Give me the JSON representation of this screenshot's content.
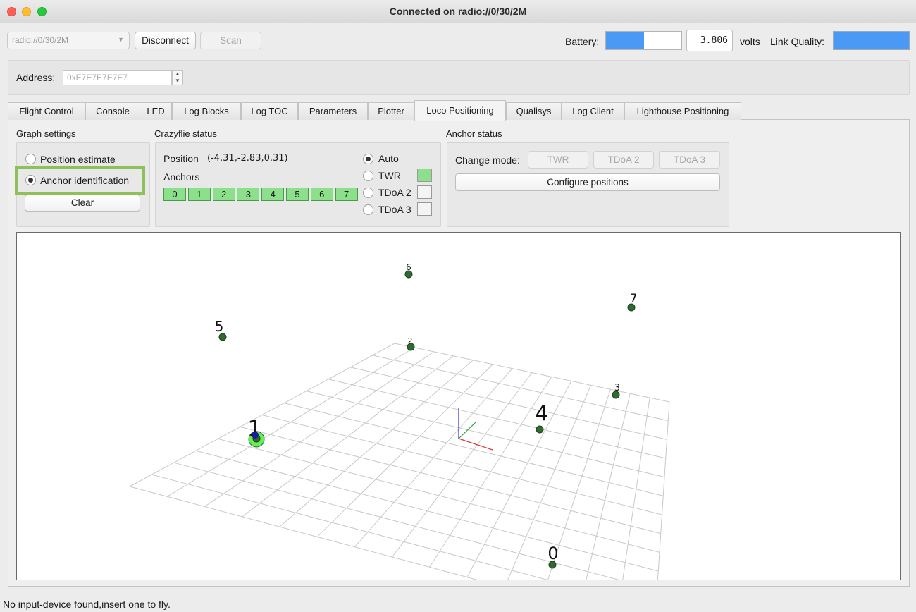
{
  "window": {
    "title": "Connected on radio://0/30/2M"
  },
  "connection": {
    "uri": "radio://0/30/2M",
    "disconnect_label": "Disconnect",
    "scan_label": "Scan",
    "battery_label": "Battery:",
    "battery_level": 0.5,
    "voltage": "3.806",
    "volts_label": "volts",
    "link_quality_label": "Link Quality:",
    "link_quality_level": 1.0
  },
  "address": {
    "label": "Address:",
    "value": "0xE7E7E7E7E7"
  },
  "tabs": [
    {
      "label": "Flight Control",
      "active": false
    },
    {
      "label": "Console",
      "active": false
    },
    {
      "label": "LED",
      "active": false
    },
    {
      "label": "Log Blocks",
      "active": false
    },
    {
      "label": "Log TOC",
      "active": false
    },
    {
      "label": "Parameters",
      "active": false
    },
    {
      "label": "Plotter",
      "active": false
    },
    {
      "label": "Loco Positioning",
      "active": true
    },
    {
      "label": "Qualisys",
      "active": false
    },
    {
      "label": "Log Client",
      "active": false
    },
    {
      "label": "Lighthouse Positioning",
      "active": false
    }
  ],
  "graph_settings": {
    "title": "Graph settings",
    "position_estimate_label": "Position estimate",
    "anchor_identification_label": "Anchor identification",
    "selected": "anchor_identification",
    "clear_label": "Clear"
  },
  "crazyflie_status": {
    "title": "Crazyflie status",
    "position_label": "Position",
    "position_value": "(-4.31,-2.83,0.31)",
    "anchors_label": "Anchors",
    "anchors": [
      "0",
      "1",
      "2",
      "3",
      "4",
      "5",
      "6",
      "7"
    ],
    "modes": [
      {
        "label": "Auto",
        "checked": true,
        "swatch": null
      },
      {
        "label": "TWR",
        "checked": false,
        "swatch": "#8ce08c"
      },
      {
        "label": "TDoA 2",
        "checked": false,
        "swatch": "#f4f4f4"
      },
      {
        "label": "TDoA 3",
        "checked": false,
        "swatch": "#f4f4f4"
      }
    ]
  },
  "anchor_status": {
    "title": "Anchor status",
    "change_mode_label": "Change mode:",
    "twr_label": "TWR",
    "tdoa2_label": "TDoA 2",
    "tdoa3_label": "TDoA 3",
    "configure_label": "Configure positions"
  },
  "view3d": {
    "anchor_labels": [
      "0",
      "1",
      "2",
      "3",
      "4",
      "5",
      "6",
      "7"
    ],
    "colors": {
      "anchor": "#2e6b2e",
      "crazyflie": "#66ee55",
      "estimate": "#1a1aa0",
      "axis_x": "#e03030",
      "axis_y": "#30a030",
      "axis_z": "#3030e0"
    }
  },
  "status_bar": {
    "text": "No input-device found,insert one to fly."
  }
}
